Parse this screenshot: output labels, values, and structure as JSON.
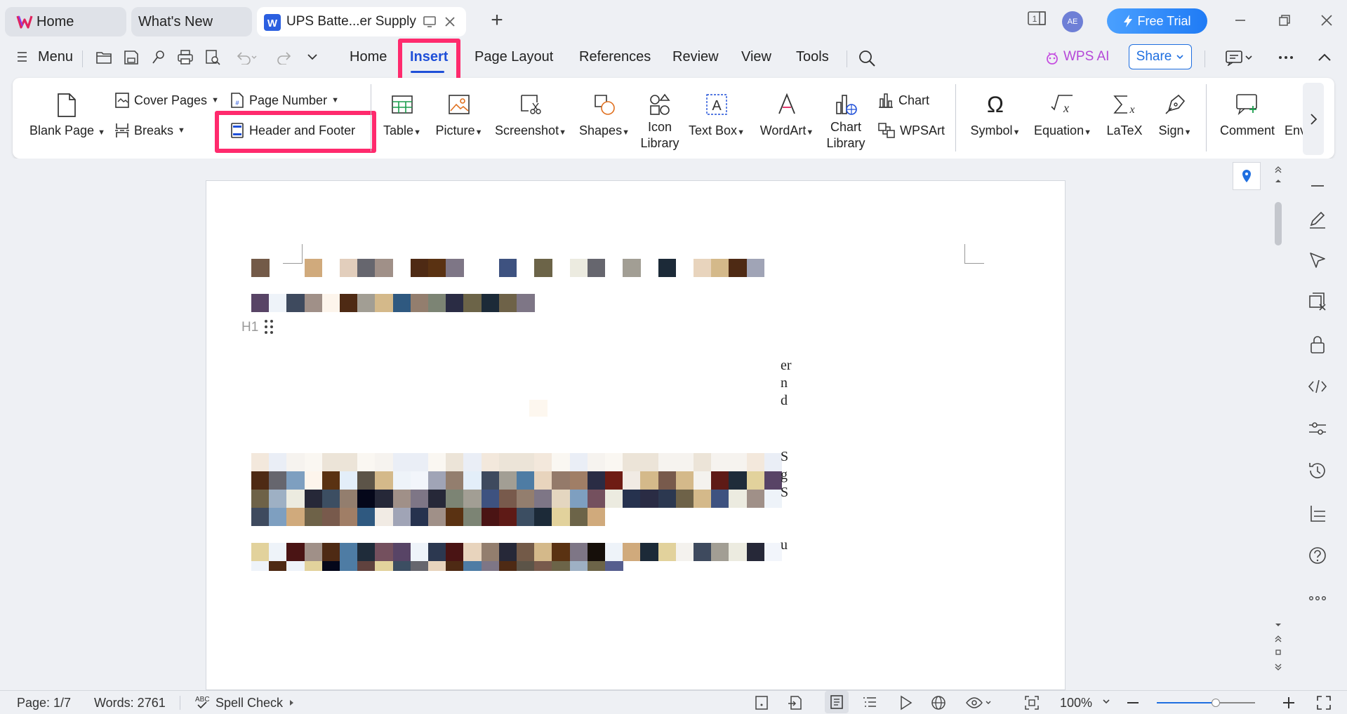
{
  "tabs": {
    "home_label": "Home",
    "whats_new_label": "What's New",
    "doc_label": "UPS Batte...er Supply"
  },
  "titlebar": {
    "avatar_initials": "AE",
    "free_trial_label": "Free Trial",
    "page_count_badge": "1"
  },
  "menu": {
    "menu_label": "Menu",
    "items": [
      "Home",
      "Insert",
      "Page Layout",
      "References",
      "Review",
      "View",
      "Tools"
    ],
    "active": "Insert",
    "wps_ai_label": "WPS AI",
    "share_label": "Share"
  },
  "ribbon": {
    "blank_page": "Blank Page",
    "cover_pages": "Cover Pages",
    "breaks": "Breaks",
    "page_number": "Page Number",
    "header_footer": "Header and Footer",
    "table": "Table",
    "picture": "Picture",
    "screenshot": "Screenshot",
    "shapes": "Shapes",
    "icon_library_1": "Icon",
    "icon_library_2": "Library",
    "text_box": "Text Box",
    "wordart": "WordArt",
    "chart_library_1": "Chart",
    "chart_library_2": "Library",
    "chart": "Chart",
    "wpsart": "WPSArt",
    "symbol": "Symbol",
    "equation": "Equation",
    "latex": "LaTeX",
    "sign": "Sign",
    "comment": "Comment",
    "env": "Env"
  },
  "document": {
    "heading_marker": "H1",
    "edge_letters": [
      "er",
      "n",
      "d",
      "S",
      "g",
      "S",
      "u"
    ]
  },
  "status": {
    "page": "Page: 1/7",
    "words": "Words: 2761",
    "spell_check": "Spell Check",
    "zoom": "100%",
    "zoom_level": 0.6
  },
  "colors": {
    "accent": "#1f4fd8",
    "highlight": "#ff2a6d",
    "free_trial": "#1f7bf5"
  }
}
